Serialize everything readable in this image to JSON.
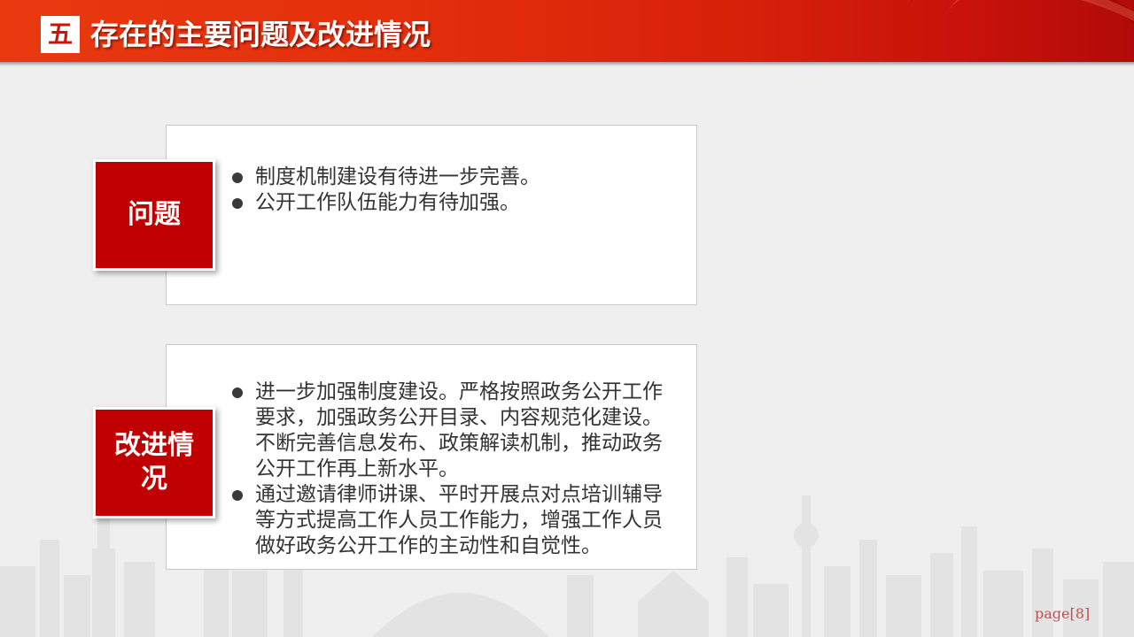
{
  "header": {
    "section_number": "五",
    "title": "存在的主要问题及改进情况"
  },
  "problems": {
    "label": "问题",
    "items": [
      "制度机制建设有待进一步完善。",
      "公开工作队伍能力有待加强。"
    ]
  },
  "improvements": {
    "label": "改进情况",
    "items": [
      "进一步加强制度建设。严格按照政务公开工作要求，加强政务公开目录、内容规范化建设。不断完善信息发布、政策解读机制，推动政务公开工作再上新水平。",
      "通过邀请律师讲课、平时开展点对点培训辅导等方式提高工作人员工作能力，增强工作人员做好政务公开工作的主动性和自觉性。"
    ]
  },
  "footer": {
    "page": "page[8]"
  },
  "colors": {
    "accent_red": "#c00000",
    "header_red": "#e4300c",
    "page_number": "#c0504d"
  }
}
